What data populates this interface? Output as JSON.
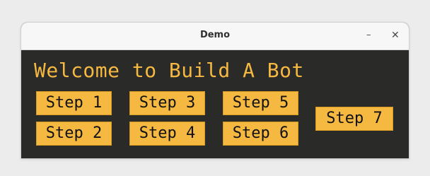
{
  "window": {
    "title": "Demo",
    "minimize_icon": "minimize-icon",
    "close_icon": "close-icon",
    "minimize_glyph": "–",
    "close_glyph": "✕"
  },
  "content": {
    "heading": "Welcome to Build A Bot",
    "buttons": [
      {
        "label": "Step 1"
      },
      {
        "label": "Step 2"
      },
      {
        "label": "Step 3"
      },
      {
        "label": "Step 4"
      },
      {
        "label": "Step 5"
      },
      {
        "label": "Step 6"
      },
      {
        "label": "Step 7"
      }
    ]
  },
  "colors": {
    "background": "#2a2a28",
    "accent": "#f5b942",
    "button_text": "#111111"
  }
}
